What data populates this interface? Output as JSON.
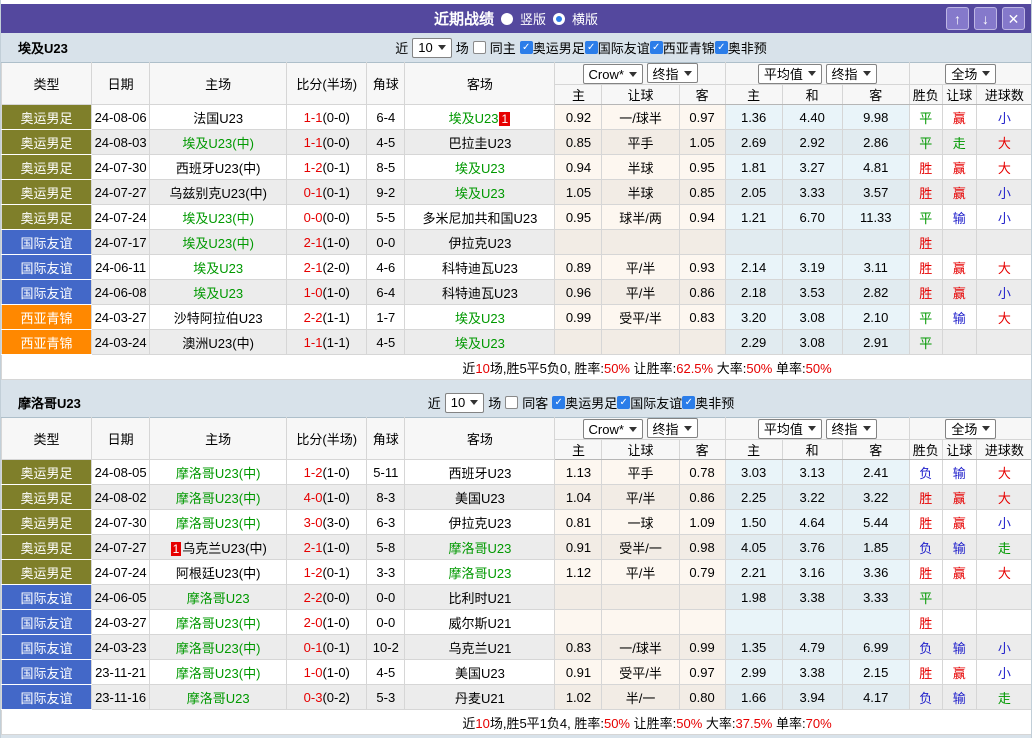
{
  "colors": {
    "purple": "#54489e",
    "olive_league": "#7f7f2a",
    "blue_league": "#4368c8",
    "orange_league": "#ff8800",
    "red": "#e60000",
    "green": "#009900",
    "blue": "#2222cc",
    "checkbox_blue": "#2b7de9"
  },
  "titlebar": {
    "title": "近期战绩",
    "radio_vertical": "竖版",
    "radio_horizontal": "横版",
    "selected": "horizontal",
    "icons": {
      "up": "↑",
      "down": "↓",
      "close": "✕"
    }
  },
  "headers": {
    "type": "类型",
    "date": "日期",
    "home": "主场",
    "score": "比分(半场)",
    "corner": "角球",
    "away": "客场",
    "h": "主",
    "handicap": "让球",
    "a": "客",
    "h2": "主",
    "draw": "和",
    "a2": "客",
    "result": "胜负",
    "rlet": "让球",
    "goals": "进球数"
  },
  "sections": [
    {
      "team": "埃及U23",
      "filter": {
        "near": "近",
        "count": "10",
        "games": "场",
        "same": "同主",
        "leagues": [
          "奥运男足",
          "国际友谊",
          "西亚青锦",
          "奥非预"
        ]
      },
      "selects": {
        "crow": "Crow*",
        "zhong1": "终指",
        "avg": "平均值",
        "zhong2": "终指",
        "scope": "全场"
      },
      "rows": [
        {
          "league": "奥运男足",
          "lc": "olive",
          "date": "24-08-06",
          "home": "法国U23",
          "hg": false,
          "score": "1-1",
          "half": "(0-0)",
          "corner": "6-4",
          "away": "埃及U23",
          "ag": true,
          "ab": "1",
          "abp": "after",
          "o1": "0.92",
          "o2": "一/球半",
          "o3": "0.97",
          "e1": "1.36",
          "e2": "4.40",
          "e3": "9.98",
          "r1": "平",
          "r1c": "g",
          "r2": "赢",
          "r2c": "r",
          "r3": "小",
          "r3c": "b"
        },
        {
          "league": "奥运男足",
          "lc": "olive",
          "date": "24-08-03",
          "home": "埃及U23(中)",
          "hg": true,
          "score": "1-1",
          "half": "(0-0)",
          "corner": "4-5",
          "away": "巴拉圭U23",
          "ag": false,
          "o1": "0.85",
          "o2": "平手",
          "o3": "1.05",
          "e1": "2.69",
          "e2": "2.92",
          "e3": "2.86",
          "r1": "平",
          "r1c": "g",
          "r2": "走",
          "r2c": "g",
          "r3": "大",
          "r3c": "r"
        },
        {
          "league": "奥运男足",
          "lc": "olive",
          "date": "24-07-30",
          "home": "西班牙U23(中)",
          "hg": false,
          "score": "1-2",
          "half": "(0-1)",
          "corner": "8-5",
          "away": "埃及U23",
          "ag": true,
          "o1": "0.94",
          "o2": "半球",
          "o3": "0.95",
          "e1": "1.81",
          "e2": "3.27",
          "e3": "4.81",
          "r1": "胜",
          "r1c": "r",
          "r2": "赢",
          "r2c": "r",
          "r3": "大",
          "r3c": "r"
        },
        {
          "league": "奥运男足",
          "lc": "olive",
          "date": "24-07-27",
          "home": "乌兹别克U23(中)",
          "hg": false,
          "score": "0-1",
          "half": "(0-1)",
          "corner": "9-2",
          "away": "埃及U23",
          "ag": true,
          "o1": "1.05",
          "o2": "半球",
          "o3": "0.85",
          "e1": "2.05",
          "e2": "3.33",
          "e3": "3.57",
          "r1": "胜",
          "r1c": "r",
          "r2": "赢",
          "r2c": "r",
          "r3": "小",
          "r3c": "b"
        },
        {
          "league": "奥运男足",
          "lc": "olive",
          "date": "24-07-24",
          "home": "埃及U23(中)",
          "hg": true,
          "score": "0-0",
          "half": "(0-0)",
          "corner": "5-5",
          "away": "多米尼加共和国U23",
          "ag": false,
          "o1": "0.95",
          "o2": "球半/两",
          "o3": "0.94",
          "e1": "1.21",
          "e2": "6.70",
          "e3": "11.33",
          "r1": "平",
          "r1c": "g",
          "r2": "输",
          "r2c": "b",
          "r3": "小",
          "r3c": "b"
        },
        {
          "league": "国际友谊",
          "lc": "blue",
          "date": "24-07-17",
          "home": "埃及U23(中)",
          "hg": true,
          "score": "2-1",
          "half": "(1-0)",
          "corner": "0-0",
          "away": "伊拉克U23",
          "ag": false,
          "o1": "",
          "o2": "",
          "o3": "",
          "e1": "",
          "e2": "",
          "e3": "",
          "r1": "胜",
          "r1c": "r",
          "r2": "",
          "r2c": "",
          "r3": "",
          "r3c": ""
        },
        {
          "league": "国际友谊",
          "lc": "blue",
          "date": "24-06-11",
          "home": "埃及U23",
          "hg": true,
          "score": "2-1",
          "half": "(2-0)",
          "corner": "4-6",
          "away": "科特迪瓦U23",
          "ag": false,
          "o1": "0.89",
          "o2": "平/半",
          "o3": "0.93",
          "e1": "2.14",
          "e2": "3.19",
          "e3": "3.11",
          "r1": "胜",
          "r1c": "r",
          "r2": "赢",
          "r2c": "r",
          "r3": "大",
          "r3c": "r"
        },
        {
          "league": "国际友谊",
          "lc": "blue",
          "date": "24-06-08",
          "home": "埃及U23",
          "hg": true,
          "score": "1-0",
          "half": "(1-0)",
          "corner": "6-4",
          "away": "科特迪瓦U23",
          "ag": false,
          "o1": "0.96",
          "o2": "平/半",
          "o3": "0.86",
          "e1": "2.18",
          "e2": "3.53",
          "e3": "2.82",
          "r1": "胜",
          "r1c": "r",
          "r2": "赢",
          "r2c": "r",
          "r3": "小",
          "r3c": "b"
        },
        {
          "league": "西亚青锦",
          "lc": "orange",
          "date": "24-03-27",
          "home": "沙特阿拉伯U23",
          "hg": false,
          "score": "2-2",
          "half": "(1-1)",
          "corner": "1-7",
          "away": "埃及U23",
          "ag": true,
          "o1": "0.99",
          "o2": "受平/半",
          "o3": "0.83",
          "e1": "3.20",
          "e2": "3.08",
          "e3": "2.10",
          "r1": "平",
          "r1c": "g",
          "r2": "输",
          "r2c": "b",
          "r3": "大",
          "r3c": "r"
        },
        {
          "league": "西亚青锦",
          "lc": "orange",
          "date": "24-03-24",
          "home": "澳洲U23(中)",
          "hg": false,
          "score": "1-1",
          "half": "(1-1)",
          "corner": "4-5",
          "away": "埃及U23",
          "ag": true,
          "o1": "",
          "o2": "",
          "o3": "",
          "e1": "2.29",
          "e2": "3.08",
          "e3": "2.91",
          "r1": "平",
          "r1c": "g",
          "r2": "",
          "r2c": "",
          "r3": "",
          "r3c": ""
        }
      ],
      "summary": [
        {
          "t": "近"
        },
        {
          "t": "10",
          "red": true
        },
        {
          "t": "场,胜5平5负0, 胜率:"
        },
        {
          "t": "50%",
          "red": true
        },
        {
          "t": " 让胜率:"
        },
        {
          "t": "62.5%",
          "red": true
        },
        {
          "t": " 大率:"
        },
        {
          "t": "50%",
          "red": true
        },
        {
          "t": " 单率:"
        },
        {
          "t": "50%",
          "red": true
        }
      ]
    },
    {
      "team": "摩洛哥U23",
      "filter": {
        "near": "近",
        "count": "10",
        "games": "场",
        "same": "同客",
        "leagues": [
          "奥运男足",
          "国际友谊",
          "奥非预"
        ]
      },
      "selects": {
        "crow": "Crow*",
        "zhong1": "终指",
        "avg": "平均值",
        "zhong2": "终指",
        "scope": "全场"
      },
      "rows": [
        {
          "league": "奥运男足",
          "lc": "olive",
          "date": "24-08-05",
          "home": "摩洛哥U23(中)",
          "hg": true,
          "score": "1-2",
          "half": "(1-0)",
          "corner": "5-11",
          "away": "西班牙U23",
          "ag": false,
          "o1": "1.13",
          "o2": "平手",
          "o3": "0.78",
          "e1": "3.03",
          "e2": "3.13",
          "e3": "2.41",
          "r1": "负",
          "r1c": "b",
          "r2": "输",
          "r2c": "b",
          "r3": "大",
          "r3c": "r"
        },
        {
          "league": "奥运男足",
          "lc": "olive",
          "date": "24-08-02",
          "home": "摩洛哥U23(中)",
          "hg": true,
          "score": "4-0",
          "half": "(1-0)",
          "corner": "8-3",
          "away": "美国U23",
          "ag": false,
          "o1": "1.04",
          "o2": "平/半",
          "o3": "0.86",
          "e1": "2.25",
          "e2": "3.22",
          "e3": "3.22",
          "r1": "胜",
          "r1c": "r",
          "r2": "赢",
          "r2c": "r",
          "r3": "大",
          "r3c": "r"
        },
        {
          "league": "奥运男足",
          "lc": "olive",
          "date": "24-07-30",
          "home": "摩洛哥U23(中)",
          "hg": true,
          "score": "3-0",
          "half": "(3-0)",
          "corner": "6-3",
          "away": "伊拉克U23",
          "ag": false,
          "o1": "0.81",
          "o2": "一球",
          "o3": "1.09",
          "e1": "1.50",
          "e2": "4.64",
          "e3": "5.44",
          "r1": "胜",
          "r1c": "r",
          "r2": "赢",
          "r2c": "r",
          "r3": "小",
          "r3c": "b"
        },
        {
          "league": "奥运男足",
          "lc": "olive",
          "date": "24-07-27",
          "home": "乌克兰U23(中)",
          "hg": false,
          "hb": "1",
          "hbp": "before",
          "score": "2-1",
          "half": "(1-0)",
          "corner": "5-8",
          "away": "摩洛哥U23",
          "ag": true,
          "o1": "0.91",
          "o2": "受半/一",
          "o3": "0.98",
          "e1": "4.05",
          "e2": "3.76",
          "e3": "1.85",
          "r1": "负",
          "r1c": "b",
          "r2": "输",
          "r2c": "b",
          "r3": "走",
          "r3c": "g"
        },
        {
          "league": "奥运男足",
          "lc": "olive",
          "date": "24-07-24",
          "home": "阿根廷U23(中)",
          "hg": false,
          "score": "1-2",
          "half": "(0-1)",
          "corner": "3-3",
          "away": "摩洛哥U23",
          "ag": true,
          "o1": "1.12",
          "o2": "平/半",
          "o3": "0.79",
          "e1": "2.21",
          "e2": "3.16",
          "e3": "3.36",
          "r1": "胜",
          "r1c": "r",
          "r2": "赢",
          "r2c": "r",
          "r3": "大",
          "r3c": "r"
        },
        {
          "league": "国际友谊",
          "lc": "blue",
          "date": "24-06-05",
          "home": "摩洛哥U23",
          "hg": true,
          "score": "2-2",
          "half": "(0-0)",
          "corner": "0-0",
          "away": "比利时U21",
          "ag": false,
          "o1": "",
          "o2": "",
          "o3": "",
          "e1": "1.98",
          "e2": "3.38",
          "e3": "3.33",
          "r1": "平",
          "r1c": "g",
          "r2": "",
          "r2c": "",
          "r3": "",
          "r3c": ""
        },
        {
          "league": "国际友谊",
          "lc": "blue",
          "date": "24-03-27",
          "home": "摩洛哥U23(中)",
          "hg": true,
          "score": "2-0",
          "half": "(1-0)",
          "corner": "0-0",
          "away": "威尔斯U21",
          "ag": false,
          "o1": "",
          "o2": "",
          "o3": "",
          "e1": "",
          "e2": "",
          "e3": "",
          "r1": "胜",
          "r1c": "r",
          "r2": "",
          "r2c": "",
          "r3": "",
          "r3c": ""
        },
        {
          "league": "国际友谊",
          "lc": "blue",
          "date": "24-03-23",
          "home": "摩洛哥U23(中)",
          "hg": true,
          "score": "0-1",
          "half": "(0-1)",
          "corner": "10-2",
          "away": "乌克兰U21",
          "ag": false,
          "o1": "0.83",
          "o2": "一/球半",
          "o3": "0.99",
          "e1": "1.35",
          "e2": "4.79",
          "e3": "6.99",
          "r1": "负",
          "r1c": "b",
          "r2": "输",
          "r2c": "b",
          "r3": "小",
          "r3c": "b"
        },
        {
          "league": "国际友谊",
          "lc": "blue",
          "date": "23-11-21",
          "home": "摩洛哥U23(中)",
          "hg": true,
          "score": "1-0",
          "half": "(1-0)",
          "corner": "4-5",
          "away": "美国U23",
          "ag": false,
          "o1": "0.91",
          "o2": "受平/半",
          "o3": "0.97",
          "e1": "2.99",
          "e2": "3.38",
          "e3": "2.15",
          "r1": "胜",
          "r1c": "r",
          "r2": "赢",
          "r2c": "r",
          "r3": "小",
          "r3c": "b"
        },
        {
          "league": "国际友谊",
          "lc": "blue",
          "date": "23-11-16",
          "home": "摩洛哥U23",
          "hg": true,
          "score": "0-3",
          "half": "(0-2)",
          "corner": "5-3",
          "away": "丹麦U21",
          "ag": false,
          "o1": "1.02",
          "o2": "半/一",
          "o3": "0.80",
          "e1": "1.66",
          "e2": "3.94",
          "e3": "4.17",
          "r1": "负",
          "r1c": "b",
          "r2": "输",
          "r2c": "b",
          "r3": "走",
          "r3c": "g"
        }
      ],
      "summary": [
        {
          "t": "近"
        },
        {
          "t": "10",
          "red": true
        },
        {
          "t": "场,胜5平1负4, 胜率:"
        },
        {
          "t": "50%",
          "red": true
        },
        {
          "t": " 让胜率:"
        },
        {
          "t": "50%",
          "red": true
        },
        {
          "t": " 大率:"
        },
        {
          "t": "37.5%",
          "red": true
        },
        {
          "t": " 单率:"
        },
        {
          "t": "70%",
          "red": true
        }
      ]
    }
  ]
}
